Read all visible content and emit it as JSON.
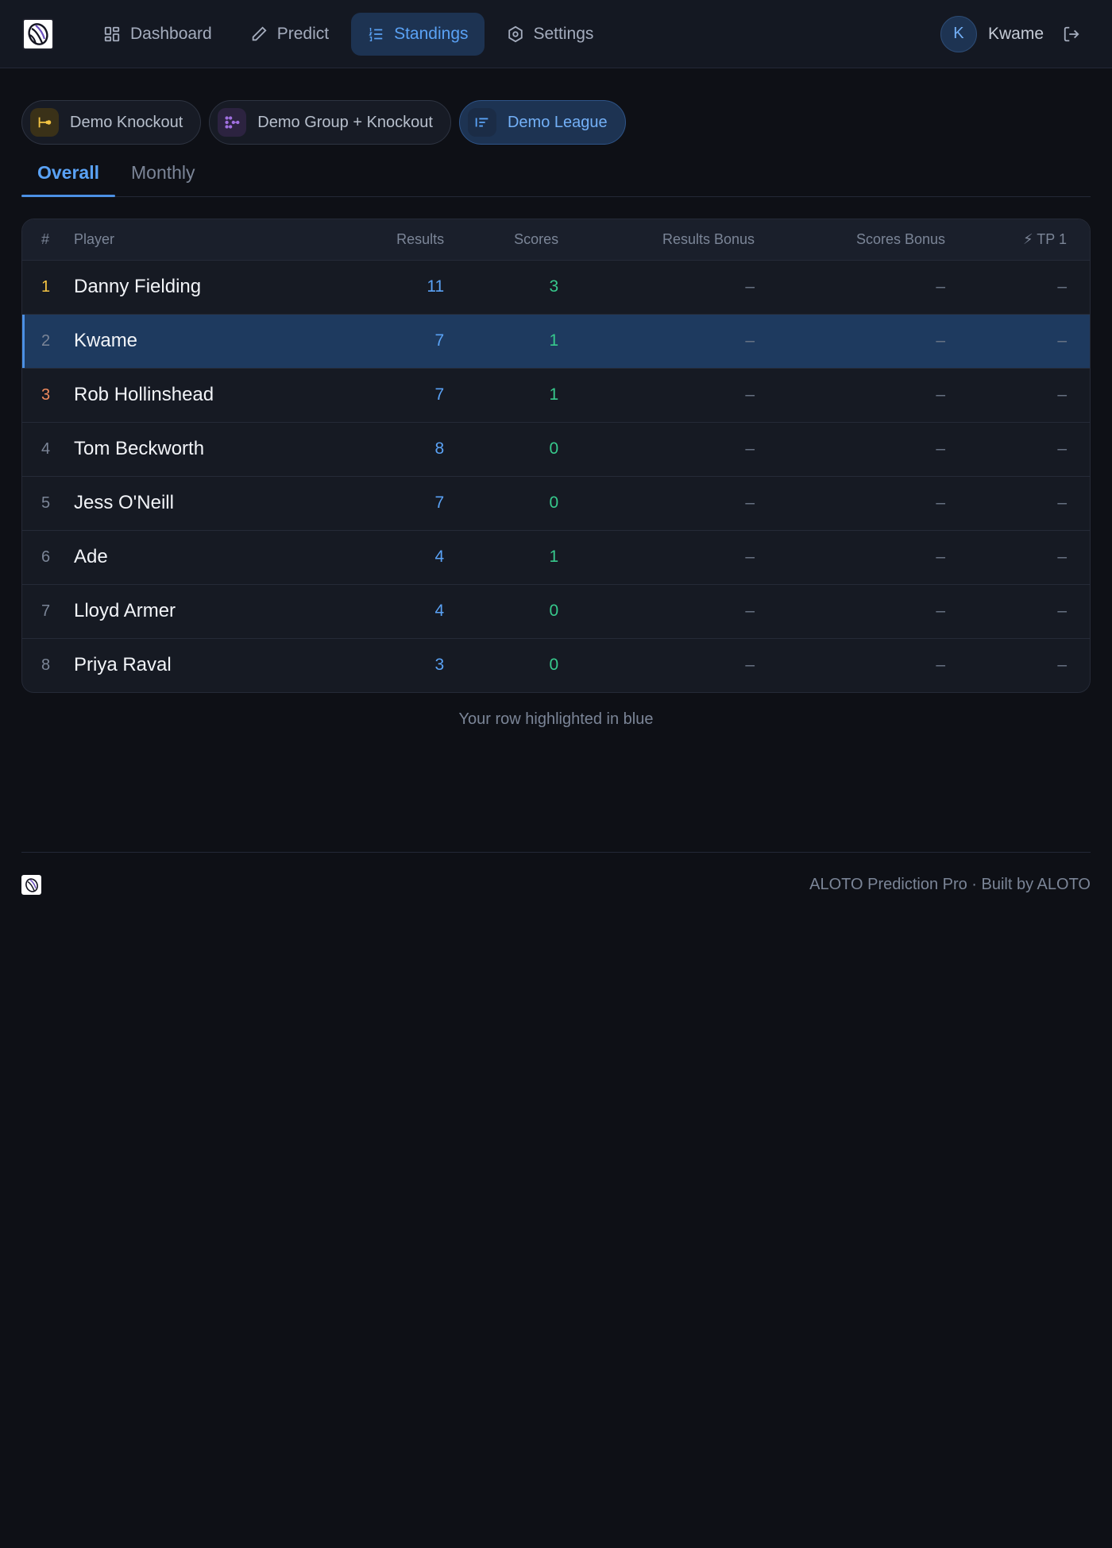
{
  "nav": {
    "items": [
      {
        "label": "Dashboard",
        "icon": "grid-icon"
      },
      {
        "label": "Predict",
        "icon": "pencil-icon"
      },
      {
        "label": "Standings",
        "icon": "ordered-list-icon",
        "active": true
      },
      {
        "label": "Settings",
        "icon": "gear-icon"
      }
    ],
    "user": {
      "initial": "K",
      "name": "Kwame"
    }
  },
  "competitions": [
    {
      "label": "Demo Knockout",
      "icon": "bracket-icon",
      "color": "#f4c443"
    },
    {
      "label": "Demo Group + Knockout",
      "icon": "group-bracket-icon",
      "color": "#a070e0"
    },
    {
      "label": "Demo League",
      "icon": "list-icon",
      "color": "#5aa2f5",
      "active": true
    }
  ],
  "tabs": [
    {
      "label": "Overall",
      "active": true
    },
    {
      "label": "Monthly"
    }
  ],
  "table": {
    "headers": {
      "rank": "#",
      "player": "Player",
      "results": "Results",
      "scores": "Scores",
      "results_bonus": "Results Bonus",
      "scores_bonus": "Scores Bonus",
      "tp": "⚡ TP 1"
    },
    "rows": [
      {
        "rank": "1",
        "player": "Danny Fielding",
        "results": "11",
        "scores": "3",
        "results_bonus": "–",
        "scores_bonus": "–",
        "tp": "–"
      },
      {
        "rank": "2",
        "player": "Kwame",
        "results": "7",
        "scores": "1",
        "results_bonus": "–",
        "scores_bonus": "–",
        "tp": "–",
        "me": true
      },
      {
        "rank": "3",
        "player": "Rob Hollinshead",
        "results": "7",
        "scores": "1",
        "results_bonus": "–",
        "scores_bonus": "–",
        "tp": "–"
      },
      {
        "rank": "4",
        "player": "Tom Beckworth",
        "results": "8",
        "scores": "0",
        "results_bonus": "–",
        "scores_bonus": "–",
        "tp": "–"
      },
      {
        "rank": "5",
        "player": "Jess O'Neill",
        "results": "7",
        "scores": "0",
        "results_bonus": "–",
        "scores_bonus": "–",
        "tp": "–"
      },
      {
        "rank": "6",
        "player": "Ade",
        "results": "4",
        "scores": "1",
        "results_bonus": "–",
        "scores_bonus": "–",
        "tp": "–"
      },
      {
        "rank": "7",
        "player": "Lloyd Armer",
        "results": "4",
        "scores": "0",
        "results_bonus": "–",
        "scores_bonus": "–",
        "tp": "–"
      },
      {
        "rank": "8",
        "player": "Priya Raval",
        "results": "3",
        "scores": "0",
        "results_bonus": "–",
        "scores_bonus": "–",
        "tp": "–"
      }
    ]
  },
  "note": "Your row highlighted in blue",
  "footer": {
    "text": "ALOTO Prediction Pro · Built by ALOTO"
  }
}
